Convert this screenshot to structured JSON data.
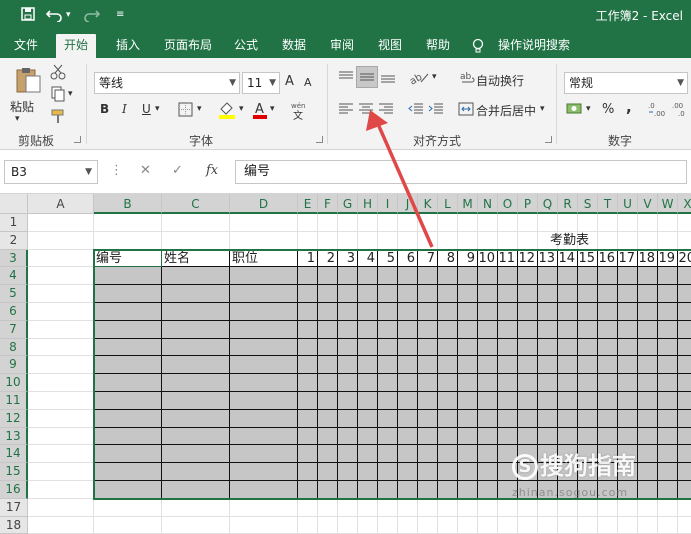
{
  "window": {
    "title": "工作簿2  -  Excel"
  },
  "quick_access": {
    "save_icon": "save-icon",
    "undo_icon": "undo-icon",
    "redo_icon": "redo-icon",
    "more_icon": "customize-icon"
  },
  "tabs": [
    {
      "label": "文件",
      "active": false
    },
    {
      "label": "开始",
      "active": true
    },
    {
      "label": "插入",
      "active": false
    },
    {
      "label": "页面布局",
      "active": false
    },
    {
      "label": "公式",
      "active": false
    },
    {
      "label": "数据",
      "active": false
    },
    {
      "label": "审阅",
      "active": false
    },
    {
      "label": "视图",
      "active": false
    },
    {
      "label": "帮助",
      "active": false
    },
    {
      "label": "操作说明搜索",
      "active": false
    }
  ],
  "ribbon": {
    "clipboard": {
      "paste_label": "粘贴",
      "group_label": "剪贴板"
    },
    "font": {
      "name": "等线",
      "size": "11",
      "bold": "B",
      "italic": "I",
      "underline": "U",
      "grow": "A",
      "shrink": "A",
      "group_label": "字体"
    },
    "alignment": {
      "wrap_label": "自动换行",
      "merge_label": "合并后居中",
      "group_label": "对齐方式"
    },
    "number": {
      "format": "常规",
      "percent": "%",
      "comma": ",",
      "group_label": "数字"
    }
  },
  "formula_bar": {
    "name_box": "B3",
    "cancel": "✕",
    "confirm": "✓",
    "fx": "fx",
    "content": "编号"
  },
  "sheet": {
    "columns": [
      "A",
      "B",
      "C",
      "D",
      "E",
      "F",
      "G",
      "H",
      "I",
      "J",
      "K",
      "L",
      "M",
      "N",
      "O",
      "P",
      "Q",
      "R",
      "S",
      "T",
      "U",
      "V",
      "W",
      "X"
    ],
    "rows": [
      "1",
      "2",
      "3",
      "4",
      "5",
      "6",
      "7",
      "8",
      "9",
      "10",
      "11",
      "12",
      "13",
      "14",
      "15",
      "16",
      "17",
      "18"
    ],
    "title_cell": "考勤表",
    "header_labels": [
      "编号",
      "姓名",
      "职位"
    ],
    "day_numbers": [
      "1",
      "2",
      "3",
      "4",
      "5",
      "6",
      "7",
      "8",
      "9",
      "10",
      "11",
      "12",
      "13",
      "14",
      "15",
      "16",
      "17",
      "18",
      "19",
      "20"
    ],
    "active_cell": "B3"
  },
  "watermark": {
    "text": "搜狗指南",
    "url_text": "zhinan.sogou.com"
  },
  "colors": {
    "accent": "#217346",
    "table_fill": "#c6c6c6",
    "arrow": "#e04848"
  }
}
